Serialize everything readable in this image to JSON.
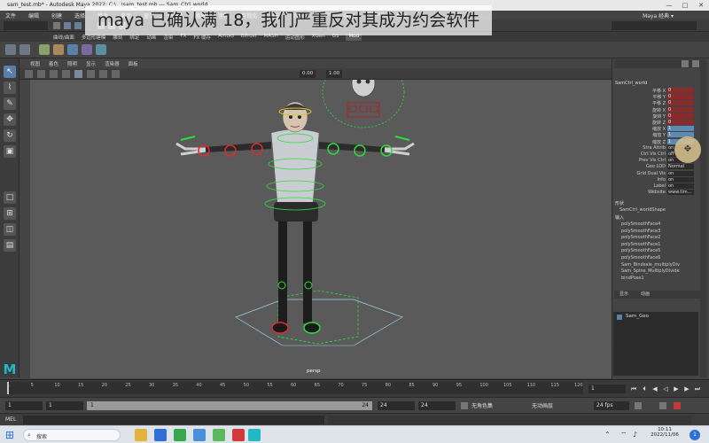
{
  "window": {
    "title": "sam_test.mb* - Autodesk Maya 2022: C:\\...\\sam_test.mb --- Sam_Ctrl_world",
    "controls": [
      "—",
      "□",
      "✕"
    ]
  },
  "watermark": "maya 已确认满 18，我们严重反对其成为约会软件",
  "menubar": {
    "items": [
      "文件",
      "编辑",
      "创建",
      "选择",
      "修改",
      "显示",
      "窗口",
      "关键帧",
      "播放",
      "音频",
      "可视化",
      "变形",
      "约束",
      "MASH",
      "缓存",
      "Arnold",
      "帮助"
    ],
    "workspace": "Maya 经典 ▾"
  },
  "shelf_tabs": {
    "items": [
      "曲线/曲面",
      "多边形建模",
      "雕刻",
      "绑定",
      "动画",
      "渲染",
      "FX",
      "FX 缓存",
      "Arnold",
      "Bifrost",
      "MASH",
      "运动图形",
      "XGen",
      "GS",
      "Mod"
    ],
    "active_index": 14
  },
  "viewport": {
    "menu": [
      "视图",
      "着色",
      "照明",
      "显示",
      "渲染器",
      "面板"
    ],
    "fields": {
      "exposure": "0.00",
      "gamma": "1.00"
    },
    "camera_label": "persp"
  },
  "attributes": {
    "node_name": "SamCtrl_world",
    "rows": [
      {
        "label": "平移 X",
        "value": "0",
        "style": "red"
      },
      {
        "label": "平移 Y",
        "value": "0",
        "style": "red"
      },
      {
        "label": "平移 Z",
        "value": "0",
        "style": "red"
      },
      {
        "label": "旋转 X",
        "value": "0",
        "style": "red"
      },
      {
        "label": "旋转 Y",
        "value": "0",
        "style": "red"
      },
      {
        "label": "旋转 Z",
        "value": "0",
        "style": "red"
      },
      {
        "label": "缩放 X",
        "value": "1",
        "style": "blue"
      },
      {
        "label": "缩放 Y",
        "value": "1",
        "style": "blue"
      },
      {
        "label": "缩放 Z",
        "value": "1",
        "style": "blue"
      },
      {
        "label": "Stra Attrib",
        "value": "on",
        "style": "plain"
      },
      {
        "label": "Ctrl Vis Ctrl",
        "value": "off",
        "style": "plain"
      },
      {
        "label": "Prev Vis Ctrl",
        "value": "on",
        "style": "plain"
      },
      {
        "label": "Geo LOD",
        "value": "Normal",
        "style": "plain"
      },
      {
        "label": "Grid Dual Vis",
        "value": "on",
        "style": "plain"
      },
      {
        "label": "Info",
        "value": "on",
        "style": "plain"
      },
      {
        "label": "Label",
        "value": "on",
        "style": "plain"
      },
      {
        "label": "Website",
        "value": "www.tim...",
        "style": "plain"
      }
    ],
    "shape_header": "形状",
    "shape_node": "SamCtrl_worldShape",
    "inputs_header": "输入",
    "inputs": [
      "polySmoothFace4",
      "polySmoothFace3",
      "polySmoothFace2",
      "polySmoothFace1",
      "polySmoothFace5",
      "polySmoothFace6",
      "Sam_Bindsale_multiplyDiv",
      "Sam_Spine_MultiplyDivide",
      "bindPose1"
    ],
    "tabs": [
      "显示",
      "动画"
    ]
  },
  "outliner": {
    "item": "Sam_Geo"
  },
  "timeline": {
    "ticks": [
      "1",
      "5",
      "10",
      "15",
      "20",
      "25",
      "30",
      "35",
      "40",
      "45",
      "50",
      "55",
      "60",
      "65",
      "70",
      "75",
      "80",
      "85",
      "90",
      "95",
      "100",
      "105",
      "110",
      "115",
      "120"
    ],
    "current_frame": "1"
  },
  "range": {
    "start": "1",
    "inner_start": "1",
    "inner_end_bar": "24",
    "end": "24",
    "anim_end": "24",
    "total_end": "24",
    "character_set": "无角色集",
    "anim_layer": "无动画层",
    "fps": "24 fps"
  },
  "command": {
    "label": "MEL"
  },
  "taskbar": {
    "search_placeholder": "搜索",
    "time": "10:11",
    "date": "2022/11/06",
    "notification_count": "1"
  },
  "colors": {
    "viewport_bg": "#5a5a5a",
    "accent_cyan": "#22b8c6",
    "ctrl_green": "#2bdc3a",
    "ctrl_red": "#e02b2b",
    "ctrl_yellow": "#d8c72c"
  }
}
